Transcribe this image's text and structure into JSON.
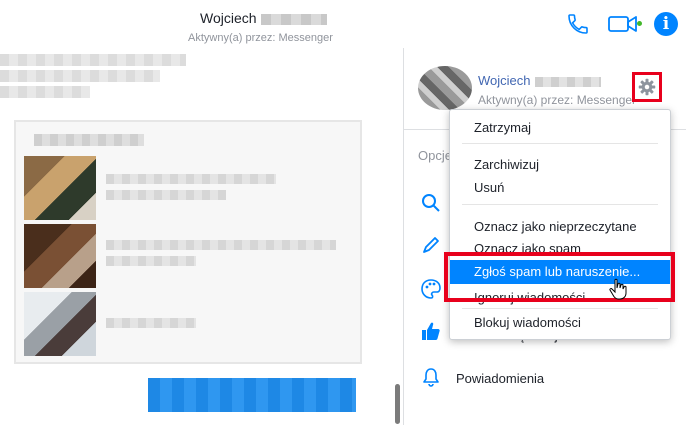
{
  "header": {
    "name": "Wojciech",
    "status": "Aktywny(a) przez: Messenger"
  },
  "profile": {
    "name": "Wojciech",
    "status": "Aktywny(a) przez: Messenger"
  },
  "sidebar": {
    "options_label": "Opcje",
    "items": [
      {
        "label": "Zmień ikonę emoji",
        "icon": "thumbs-up-icon"
      },
      {
        "label": "Powiadomienia",
        "icon": "bell-icon"
      }
    ]
  },
  "menu": {
    "items": [
      {
        "label": "Zatrzymaj"
      },
      {
        "label": "Zarchiwizuj"
      },
      {
        "label": "Usuń"
      },
      {
        "label": "Oznacz jako nieprzeczytane"
      },
      {
        "label": "Oznacz jako spam"
      },
      {
        "label": "Zgłoś spam lub naruszenie..."
      },
      {
        "label": "Ignoruj wiadomości"
      },
      {
        "label": "Blokuj wiadomości"
      }
    ],
    "selected_index": 5
  },
  "colors": {
    "accent": "#0084ff",
    "highlight_box": "#e8001c",
    "online": "#42b72a"
  }
}
